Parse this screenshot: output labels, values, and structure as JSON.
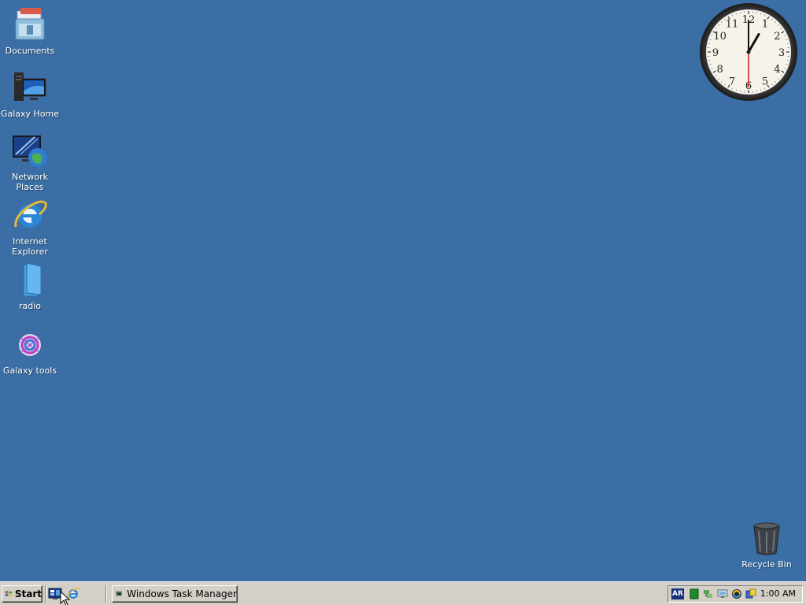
{
  "desktop": {
    "background_color": "#3a6ea5",
    "icons": [
      {
        "label": "Documents",
        "icon": "documents-folder-icon"
      },
      {
        "label": "Galaxy Home",
        "icon": "computer-icon"
      },
      {
        "label": "Network Places",
        "icon": "network-places-icon"
      },
      {
        "label": "Internet Explorer",
        "icon": "internet-explorer-icon"
      },
      {
        "label": "radio",
        "icon": "blue-folder-icon"
      },
      {
        "label": "Galaxy tools",
        "icon": "galaxy-tools-icon"
      },
      {
        "label": "Recycle Bin",
        "icon": "recycle-bin-icon"
      }
    ]
  },
  "clock_gadget": {
    "numerals": [
      "12",
      "1",
      "2",
      "3",
      "4",
      "5",
      "6",
      "7",
      "8",
      "9",
      "10",
      "11"
    ],
    "hour": 1,
    "minute": 0,
    "second": 30
  },
  "taskbar": {
    "start_label": "Start",
    "quick_launch": [
      "desktop-show-icon",
      "internet-explorer-icon"
    ],
    "tasks": [
      {
        "label": "Windows Task Manager",
        "icon": "task-manager-icon"
      }
    ],
    "tray": {
      "language": "AR",
      "icons": [
        "green-square-icon",
        "network-icon",
        "monitor-icon",
        "sync-icon",
        "security-icon"
      ],
      "time": "1:00 AM"
    }
  }
}
